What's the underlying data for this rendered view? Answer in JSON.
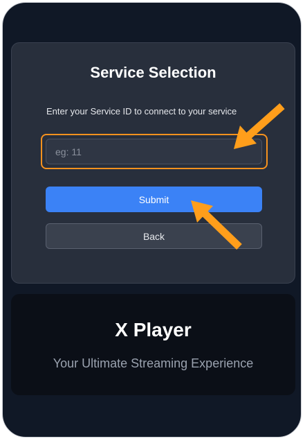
{
  "service_selection": {
    "title": "Service Selection",
    "description": "Enter your Service ID to connect to your service",
    "input_placeholder": "eg: 11",
    "input_value": "",
    "submit_label": "Submit",
    "back_label": "Back"
  },
  "branding": {
    "title": "X Player",
    "tagline": "Your Ultimate Streaming Experience"
  },
  "colors": {
    "background": "#101826",
    "card": "#282f3c",
    "accent_blue": "#3b82f6",
    "highlight_orange": "#f7921e"
  },
  "annotations": {
    "arrows": [
      "arrow-pointing-to-input-icon",
      "arrow-pointing-to-submit-icon"
    ]
  }
}
